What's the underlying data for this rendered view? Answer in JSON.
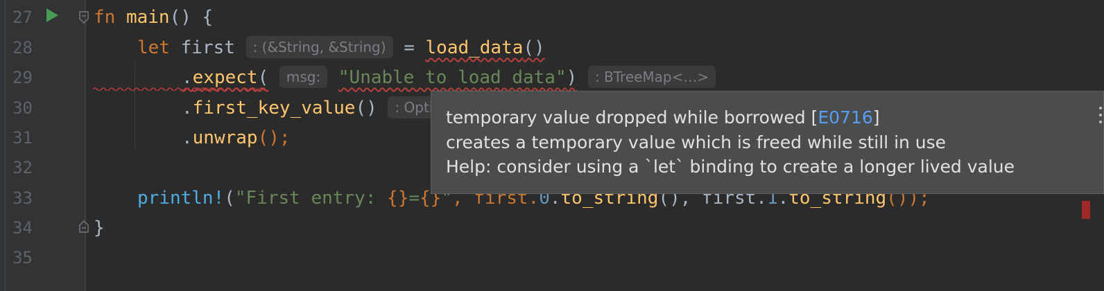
{
  "editor": {
    "line_numbers": [
      "27",
      "28",
      "29",
      "30",
      "31",
      "32",
      "33",
      "34",
      "35"
    ],
    "lines": {
      "l27": {
        "kw": "fn",
        "name": "main",
        "rest": "() {"
      },
      "l28": {
        "kw": "let",
        "var": "first",
        "hint": ": (&String, &String)",
        "eq": " = ",
        "call": "load_data",
        "paren": "()"
      },
      "l29": {
        "dot": ".",
        "method": "expect",
        "open": "(",
        "param_hint": "msg:",
        "string": "\"Unable to load data\"",
        "close": ")",
        "hint": ": BTreeMap<…>"
      },
      "l30": {
        "dot": ".",
        "method": "first_key_value",
        "paren": "()",
        "hint": ": Opti"
      },
      "l31": {
        "dot": ".",
        "method": "unwrap",
        "rest": "();"
      },
      "l33": {
        "macro": "println!",
        "open": "(",
        "str_a": "\"First entry: ",
        "fmt_a": "{}",
        "eq": "=",
        "fmt_b": "{}",
        "str_b": "\"",
        "comma1": ", first.",
        "idx0": "0",
        "dot1": ".",
        "m1": "to_string",
        "p1": "(), first.",
        "idx1": "1",
        "dot2": ".",
        "m2": "to_string",
        "end": "());"
      },
      "l34": {
        "brace": "}"
      }
    }
  },
  "tooltip": {
    "line1_prefix": "temporary value dropped while borrowed [",
    "error_code": "E0716",
    "line1_suffix": "]",
    "line2": "creates a temporary value which is freed while still in use",
    "line3": "Help: consider using a `let` binding to create a longer lived value"
  },
  "colors": {
    "background": "#2b2b2b",
    "keyword": "#cc7832",
    "function": "#ffc66d",
    "string": "#6a8759",
    "macro": "#4eade5",
    "error": "#bc3f3c",
    "link": "#589df6"
  }
}
